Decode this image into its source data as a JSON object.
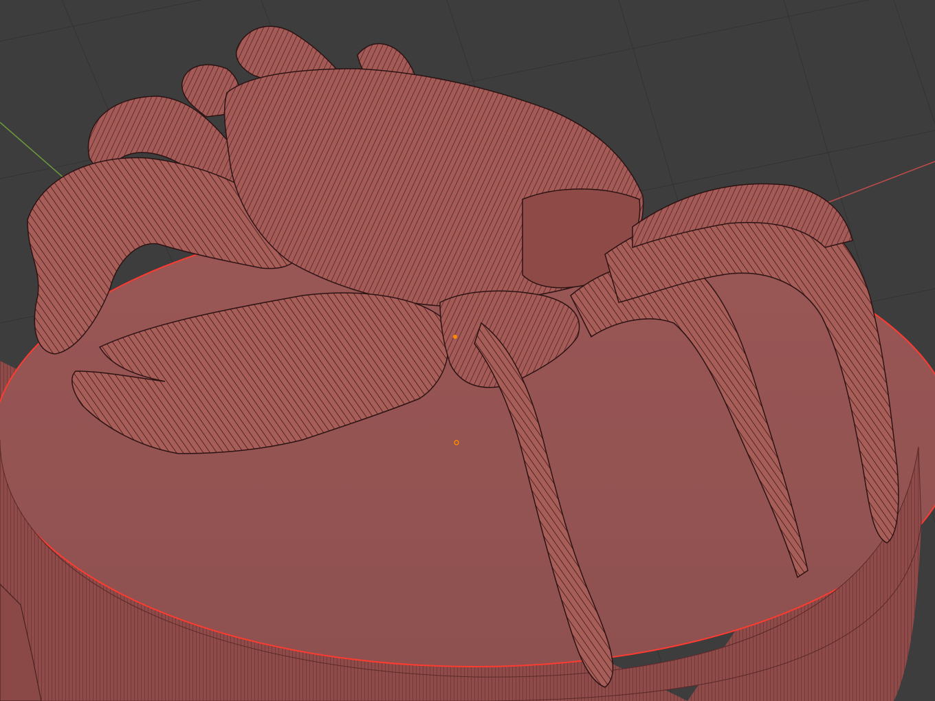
{
  "viewport": {
    "background": "#3d3d3d",
    "grid_color": "#333333",
    "model_color": "#a35a57",
    "model_shadow": "#7d4140",
    "model_highlight": "#c57670",
    "edge_color": "#2c1313",
    "selection_outline": "#ff3b30",
    "x_axis_color": "#c14b4b",
    "y_axis_color": "#6c9b3c",
    "origin_color": "#ff8a00"
  },
  "objects": [
    {
      "name": "crab",
      "selected": true,
      "shading": "solid"
    },
    {
      "name": "display-base",
      "selected": true,
      "shading": "solid"
    }
  ]
}
